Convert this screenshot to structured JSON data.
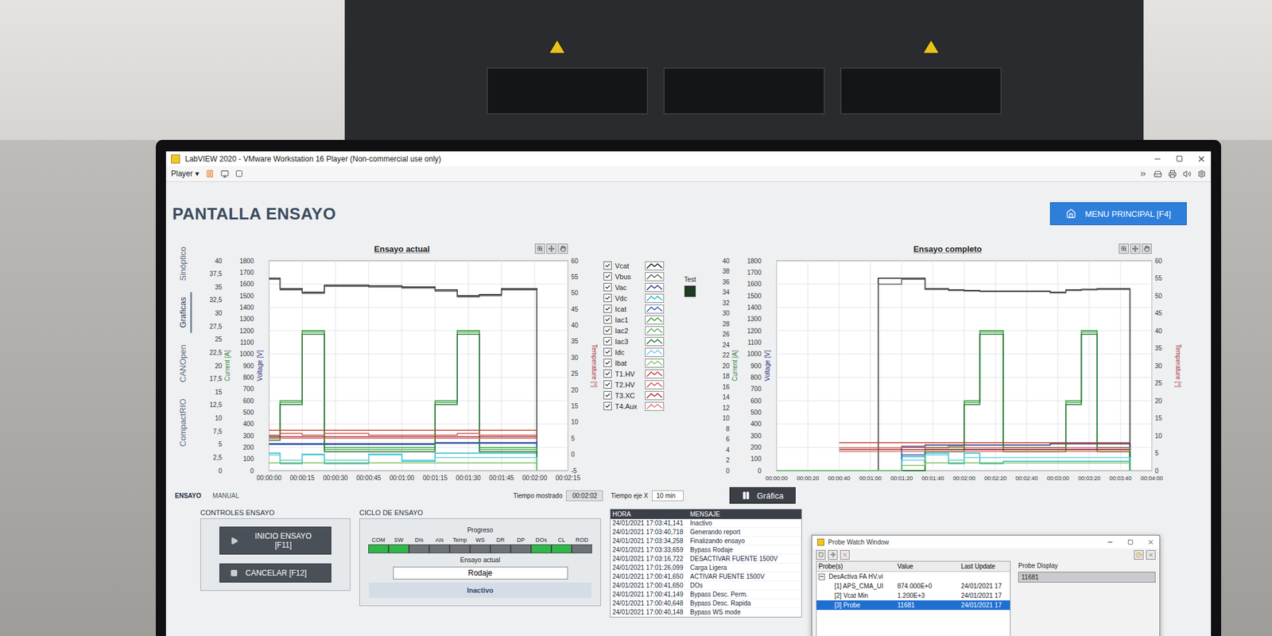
{
  "window": {
    "title": "LabVIEW 2020 - VMware Workstation 16 Player (Non-commercial use only)"
  },
  "player_menu": {
    "label": "Player",
    "arrow": "▾"
  },
  "page": {
    "title": "PANTALLA ENSAYO",
    "menu_button": "MENU PRINCIPAL [F4]"
  },
  "side_tabs": [
    {
      "label": "Sinóptico",
      "selected": false
    },
    {
      "label": "Graficas",
      "selected": true
    },
    {
      "label": "CANOpen",
      "selected": false
    },
    {
      "label": "CompactRIO",
      "selected": false
    }
  ],
  "legend": [
    {
      "label": "Vcat",
      "checked": true,
      "color": "#111111"
    },
    {
      "label": "Vbus",
      "checked": true,
      "color": "#5a5a5a"
    },
    {
      "label": "Vac",
      "checked": true,
      "color": "#1f2f7a"
    },
    {
      "label": "Vdc",
      "checked": true,
      "color": "#19b4c4"
    },
    {
      "label": "Icat",
      "checked": true,
      "color": "#2a55b8"
    },
    {
      "label": "Iac1",
      "checked": true,
      "color": "#2e9a3a"
    },
    {
      "label": "Iac2",
      "checked": true,
      "color": "#4cae4c"
    },
    {
      "label": "Iac3",
      "checked": true,
      "color": "#1f6f2c"
    },
    {
      "label": "Idc",
      "checked": true,
      "color": "#5fd0dc"
    },
    {
      "label": "Ibat",
      "checked": true,
      "color": "#7fbf5f"
    },
    {
      "label": "T1.HV",
      "checked": true,
      "color": "#c0392b"
    },
    {
      "label": "T2.HV",
      "checked": true,
      "color": "#d0504a"
    },
    {
      "label": "T3.XC",
      "checked": true,
      "color": "#a02828"
    },
    {
      "label": "T4.Aux",
      "checked": true,
      "color": "#e0706a"
    }
  ],
  "test_indicator": {
    "label": "Test",
    "on": false
  },
  "charts": [
    {
      "title": "Ensayo actual",
      "x_ticks": [
        "00:00:00",
        "00:00:15",
        "00:00:30",
        "00:00:45",
        "00:01:00",
        "00:01:15",
        "00:01:30",
        "00:01:45",
        "00:02:00",
        "00:02:15"
      ],
      "current_ticks": [
        "40",
        "37,5",
        "35",
        "32,5",
        "30",
        "27,5",
        "25",
        "22,5",
        "20",
        "17,5",
        "15",
        "12,5",
        "10",
        "7,5",
        "5",
        "2,5",
        "0"
      ],
      "voltage_ticks": [
        "1800",
        "1700",
        "1600",
        "1500",
        "1400",
        "1300",
        "1200",
        "1100",
        "1000",
        "900",
        "800",
        "700",
        "600",
        "500",
        "400",
        "300",
        "200",
        "100",
        "0"
      ],
      "temperature_ticks": [
        "60",
        "55",
        "50",
        "45",
        "40",
        "35",
        "30",
        "25",
        "20",
        "15",
        "10",
        "5",
        "0",
        "-5"
      ],
      "axis_titles": {
        "current": "Current [A]",
        "voltage": "Voltage [V]",
        "temperature": "Temperature [º]"
      },
      "t": [
        0,
        5,
        15,
        25,
        45,
        60,
        75,
        85,
        95,
        105,
        115,
        120,
        121
      ],
      "series": [
        {
          "name": "Vcat",
          "axis": "V",
          "values": [
            1650,
            1560,
            1530,
            1590,
            1585,
            1575,
            1550,
            1500,
            1510,
            1560,
            1560,
            1560,
            0
          ]
        },
        {
          "name": "Vbus",
          "axis": "V",
          "values": [
            1640,
            1550,
            1520,
            1580,
            1575,
            1565,
            1540,
            1490,
            1500,
            1550,
            1550,
            1550,
            0
          ]
        },
        {
          "name": "Vac",
          "axis": "V",
          "values": [
            230,
            230,
            230,
            230,
            230,
            230,
            240,
            240,
            240,
            240,
            240,
            240,
            0
          ]
        },
        {
          "name": "Vdc",
          "axis": "V",
          "values": [
            150,
            60,
            140,
            60,
            140,
            80,
            150,
            150,
            150,
            150,
            150,
            150,
            0
          ]
        },
        {
          "name": "Icat",
          "axis": "A",
          "values": [
            5,
            5,
            5,
            5,
            5,
            5,
            5.2,
            5.2,
            5.2,
            5.2,
            5.2,
            5.2,
            0
          ]
        },
        {
          "name": "Iac1",
          "axis": "A",
          "values": [
            6.7,
            13.3,
            26.7,
            4.4,
            4.4,
            4.4,
            13.3,
            26.7,
            4.4,
            4.4,
            4.4,
            4.4,
            0
          ]
        },
        {
          "name": "Iac2",
          "axis": "A",
          "values": [
            6.2,
            13,
            26.4,
            4,
            4,
            4,
            13,
            26.4,
            4,
            4,
            4,
            4,
            0
          ]
        },
        {
          "name": "Iac3",
          "axis": "A",
          "values": [
            5.8,
            12.6,
            26,
            3.6,
            3.6,
            3.6,
            12.6,
            26,
            3.6,
            3.6,
            3.6,
            3.6,
            0
          ]
        },
        {
          "name": "Idc",
          "axis": "A",
          "values": [
            3,
            2,
            3,
            2,
            3,
            2,
            2.5,
            2.5,
            2.5,
            2.5,
            2.5,
            2.5,
            0
          ]
        },
        {
          "name": "Ibat",
          "axis": "A",
          "values": [
            1.5,
            1.5,
            1.5,
            1.5,
            1.5,
            1.5,
            1.5,
            1.5,
            1.5,
            1.5,
            1.5,
            1.5,
            0
          ]
        },
        {
          "name": "T1.HV",
          "axis": "°C",
          "values": [
            7.5,
            7.5,
            7.5,
            7.5,
            7.5,
            7.5,
            7.5,
            7.5,
            7.5,
            7.5,
            7.5,
            7.5,
            7.5
          ]
        },
        {
          "name": "T2.HV",
          "axis": "°C",
          "values": [
            6,
            6.5,
            6,
            6.5,
            6,
            6,
            6,
            6.5,
            6,
            6,
            6,
            6,
            6
          ]
        },
        {
          "name": "T3.XC",
          "axis": "°C",
          "values": [
            5.5,
            5.5,
            5.5,
            5.5,
            5.5,
            5.5,
            5.5,
            5.5,
            5.5,
            5.5,
            5.5,
            5.5,
            5.5
          ]
        },
        {
          "name": "T4.Aux",
          "axis": "°C",
          "values": [
            5,
            5,
            5,
            5,
            5,
            5,
            5,
            5,
            5,
            5,
            5,
            5,
            5
          ]
        }
      ]
    },
    {
      "title": "Ensayo completo",
      "x_ticks": [
        "00:00:00",
        "00:00:20",
        "00:00:40",
        "00:01:00",
        "00:01:20",
        "00:01:40",
        "00:02:00",
        "00:02:20",
        "00:02:40",
        "00:03:00",
        "00:03:20",
        "00:03:40",
        "00:04:00"
      ],
      "current_ticks": [
        "40",
        "38",
        "36",
        "34",
        "32",
        "30",
        "28",
        "26",
        "24",
        "22",
        "20",
        "18",
        "16",
        "14",
        "12",
        "10",
        "8",
        "6",
        "4",
        "2",
        "0"
      ],
      "voltage_ticks": [
        "1800",
        "1700",
        "1600",
        "1500",
        "1400",
        "1300",
        "1200",
        "1100",
        "1000",
        "900",
        "800",
        "700",
        "600",
        "500",
        "400",
        "300",
        "200",
        "100",
        "0"
      ],
      "temperature_ticks": [
        "60",
        "55",
        "50",
        "45",
        "40",
        "35",
        "30",
        "25",
        "20",
        "15",
        "10",
        "5",
        "0"
      ],
      "axis_titles": {
        "current": "Current [A]",
        "voltage": "Voltage [V]",
        "temperature": "Temperature [º]"
      },
      "t": [
        0,
        40,
        65,
        80,
        95,
        110,
        120,
        130,
        145,
        175,
        185,
        195,
        205,
        226
      ],
      "series": [
        {
          "name": "Vcat",
          "axis": "V",
          "values": [
            0,
            0,
            1650,
            1650,
            1560,
            1550,
            1545,
            1540,
            1540,
            1530,
            1550,
            1555,
            1560,
            0
          ]
        },
        {
          "name": "Vbus",
          "axis": "V",
          "values": [
            0,
            0,
            1600,
            1640,
            1555,
            1545,
            1540,
            1535,
            1535,
            1525,
            1545,
            1550,
            1555,
            0
          ]
        },
        {
          "name": "Vac",
          "axis": "V",
          "values": [
            0,
            0,
            0,
            200,
            220,
            220,
            220,
            220,
            220,
            230,
            230,
            230,
            230,
            0
          ]
        },
        {
          "name": "Vdc",
          "axis": "V",
          "values": [
            0,
            0,
            0,
            120,
            150,
            60,
            150,
            60,
            80,
            80,
            80,
            80,
            80,
            0
          ]
        },
        {
          "name": "Icat",
          "axis": "A",
          "values": [
            0,
            0,
            0,
            3,
            4,
            4,
            4,
            4,
            4,
            4,
            4,
            4,
            4,
            0
          ]
        },
        {
          "name": "Iac1",
          "axis": "A",
          "values": [
            0,
            0,
            0,
            0,
            4.4,
            4.4,
            13.3,
            26.7,
            4.4,
            4.4,
            13.3,
            26.7,
            4.4,
            0
          ]
        },
        {
          "name": "Iac2",
          "axis": "A",
          "values": [
            0,
            0,
            0,
            0,
            4,
            4,
            13,
            26.4,
            4,
            4,
            13,
            26.4,
            4,
            0
          ]
        },
        {
          "name": "Iac3",
          "axis": "A",
          "values": [
            0,
            0,
            0,
            0,
            3.6,
            3.6,
            12.6,
            26,
            3.6,
            3.6,
            12.6,
            26,
            3.6,
            0
          ]
        },
        {
          "name": "Idc",
          "axis": "A",
          "values": [
            0,
            0,
            0,
            2,
            3,
            2,
            2.5,
            2.5,
            2.5,
            2.5,
            2.5,
            2.5,
            2.5,
            0
          ]
        },
        {
          "name": "Ibat",
          "axis": "A",
          "values": [
            0,
            0,
            0,
            1,
            1.5,
            1.5,
            1.5,
            1.5,
            1.5,
            1.5,
            1.5,
            1.5,
            1.5,
            0
          ]
        },
        {
          "name": "T1.HV",
          "axis": "°C",
          "values": [
            null,
            8,
            8,
            8,
            8,
            8,
            8,
            8,
            8,
            8,
            8,
            8,
            8,
            8
          ]
        },
        {
          "name": "T2.HV",
          "axis": "°C",
          "values": [
            null,
            6.5,
            6.5,
            7,
            6.5,
            7,
            6.5,
            6.5,
            6.5,
            6.5,
            6.5,
            6.5,
            6.5,
            6.5
          ]
        },
        {
          "name": "T3.XC",
          "axis": "°C",
          "values": [
            null,
            6,
            6,
            6,
            6,
            6,
            6,
            6,
            6,
            6,
            6,
            6,
            6,
            6
          ]
        },
        {
          "name": "T4.Aux",
          "axis": "°C",
          "values": [
            null,
            5.5,
            5.5,
            5.5,
            5.5,
            5.5,
            5.5,
            5.5,
            5.5,
            5.5,
            5.5,
            5.5,
            5.5,
            5.5
          ]
        }
      ]
    }
  ],
  "mode_tabs": [
    {
      "label": "ENSAYO",
      "selected": true
    },
    {
      "label": "MANUAL",
      "selected": false
    }
  ],
  "time_controls": {
    "shown_label": "Tiempo mostrado",
    "shown_value": "00:02:02",
    "axis_label": "Tiempo eje X",
    "axis_value": "10 min"
  },
  "graph_button": {
    "label": "Gráfica"
  },
  "test_controls": {
    "title": "CONTROLES ENSAYO",
    "start": "INICIO ENSAYO [F11]",
    "cancel": "CANCELAR [F12]"
  },
  "cycle": {
    "title": "CICLO DE ENSAYO",
    "progress_label": "Progreso",
    "steps": [
      {
        "label": "COM",
        "done": true
      },
      {
        "label": "SW",
        "done": true
      },
      {
        "label": "DIs",
        "done": false
      },
      {
        "label": "AIs",
        "done": false
      },
      {
        "label": "Temp",
        "done": false
      },
      {
        "label": "WS",
        "done": false
      },
      {
        "label": "DR",
        "done": false
      },
      {
        "label": "DP",
        "done": false
      },
      {
        "label": "DOs",
        "done": true
      },
      {
        "label": "CL",
        "done": true
      },
      {
        "label": "ROD",
        "done": false
      }
    ],
    "current_label": "Ensayo actual",
    "current_value": "Rodaje",
    "status": "Inactivo"
  },
  "log": {
    "columns": [
      "HORA",
      "MENSAJE"
    ],
    "rows": [
      {
        "time": "24/01/2021 17:03:41,141",
        "message": "Inactivo"
      },
      {
        "time": "24/01/2021 17:03:40,718",
        "message": "Generando report"
      },
      {
        "time": "24/01/2021 17:03:34,258",
        "message": "Finalizando ensayo"
      },
      {
        "time": "24/01/2021 17:03:33,659",
        "message": "Bypass Rodaje"
      },
      {
        "time": "24/01/2021 17:03:16,722",
        "message": "DESACTIVAR FUENTE 1500V"
      },
      {
        "time": "24/01/2021 17:01:26,099",
        "message": "Carga Ligera"
      },
      {
        "time": "24/01/2021 17:00:41,650",
        "message": "ACTIVAR FUENTE 1500V"
      },
      {
        "time": "24/01/2021 17:00:41,650",
        "message": "DOs"
      },
      {
        "time": "24/01/2021 17:00:41,149",
        "message": "Bypass Desc. Perm."
      },
      {
        "time": "24/01/2021 17:00:40,648",
        "message": "Bypass Desc. Rapida"
      },
      {
        "time": "24/01/2021 17:00:40,148",
        "message": "Bypass WS mode"
      }
    ]
  },
  "probe_window": {
    "title": "Probe Watch Window",
    "columns": [
      "Probe(s)",
      "Value",
      "Last Update"
    ],
    "display_title": "Probe Display",
    "display_value": "11681",
    "group": {
      "label": "DesActiva FA HV.vi",
      "expanded": true
    },
    "rows": [
      {
        "label": "[1] APS_CMA_UI",
        "value": "874.000E+0",
        "updated": "24/01/2021 17",
        "selected": false
      },
      {
        "label": "[2] Vcat Min",
        "value": "1.200E+3",
        "updated": "24/01/2021 17",
        "selected": false
      },
      {
        "label": "[3] Probe",
        "value": "11681",
        "updated": "24/01/2021 17",
        "selected": true
      }
    ]
  }
}
